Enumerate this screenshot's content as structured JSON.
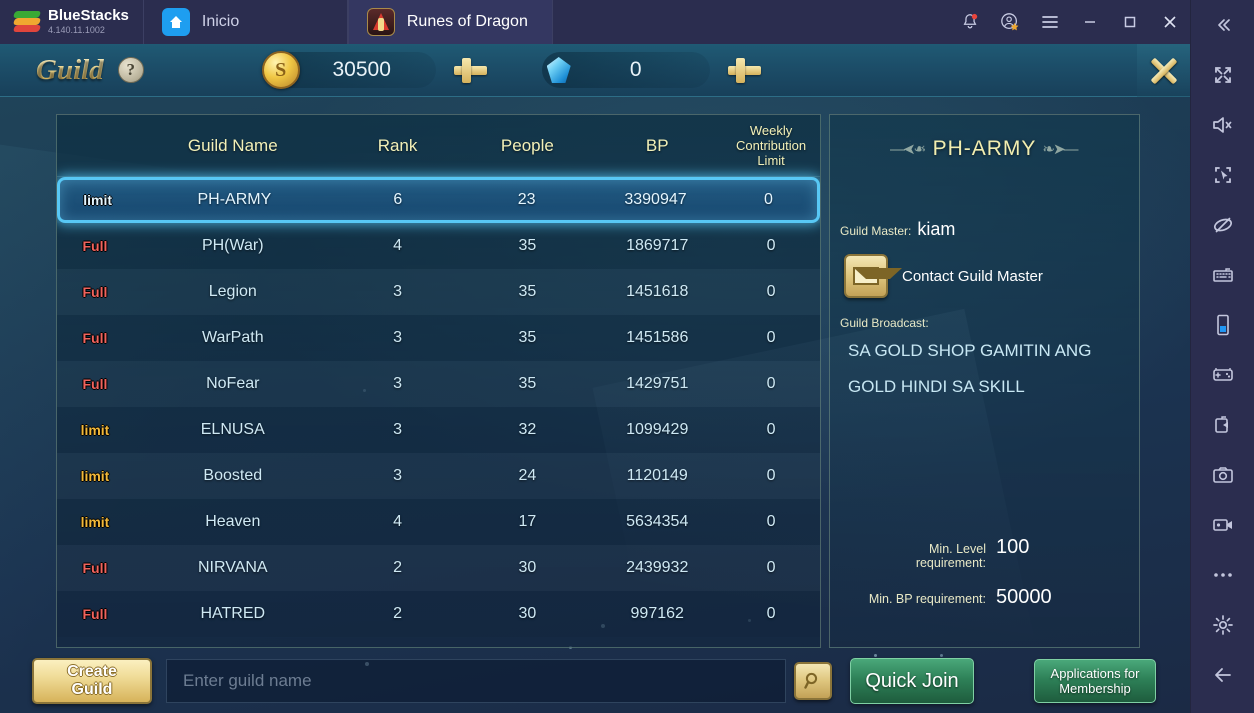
{
  "bluestacks": {
    "brand": "BlueStacks",
    "version": "4.140.11.1002",
    "tabs": [
      {
        "label": "Inicio",
        "icon": "home-icon"
      },
      {
        "label": "Runes of Dragon",
        "icon": "game-icon"
      }
    ],
    "window_buttons": [
      "notifications-bell-icon",
      "account-star-icon",
      "menu-icon",
      "minimize-icon",
      "maximize-icon",
      "close-icon"
    ],
    "sidebar_icons": [
      "collapse-chevrons-icon",
      "fullscreen-icon",
      "mute-icon",
      "cursor-target-icon",
      "eye-off-icon",
      "keyboard-icon",
      "phone-rotate-icon",
      "gamepad-icon",
      "multi-instance-icon",
      "screenshot-camera-icon",
      "record-video-icon",
      "more-options-icon",
      "settings-gear-icon",
      "back-arrow-icon"
    ]
  },
  "header": {
    "title": "Guild",
    "help_icon": "help-question-icon",
    "gold_icon": "gold-coin-icon",
    "gold": "30500",
    "gold_add": "add-gold-button",
    "gem_icon": "blue-gem-icon",
    "gems": "0",
    "gem_add": "add-gem-button",
    "close_icon": "close-screen-icon"
  },
  "table": {
    "columns": [
      "",
      "Guild Name",
      "Rank",
      "People",
      "BP",
      "Weekly\nContribution Limit"
    ],
    "col_guild_name": "Guild Name",
    "col_rank": "Rank",
    "col_people": "People",
    "col_bp": "BP",
    "col_weekly_l1": "Weekly",
    "col_weekly_l2": "Contribution Limit",
    "rows": [
      {
        "tag": "limit",
        "tag_type": "limit",
        "name": "PH-ARMY",
        "rank": "6",
        "people": "23",
        "bp": "3390947",
        "weekly": "0",
        "selected": true
      },
      {
        "tag": "Full",
        "tag_type": "full",
        "name": "PH(War)",
        "rank": "4",
        "people": "35",
        "bp": "1869717",
        "weekly": "0",
        "selected": false
      },
      {
        "tag": "Full",
        "tag_type": "full",
        "name": "Legion",
        "rank": "3",
        "people": "35",
        "bp": "1451618",
        "weekly": "0",
        "selected": false
      },
      {
        "tag": "Full",
        "tag_type": "full",
        "name": "WarPath",
        "rank": "3",
        "people": "35",
        "bp": "1451586",
        "weekly": "0",
        "selected": false
      },
      {
        "tag": "Full",
        "tag_type": "full",
        "name": "NoFear",
        "rank": "3",
        "people": "35",
        "bp": "1429751",
        "weekly": "0",
        "selected": false
      },
      {
        "tag": "limit",
        "tag_type": "limit",
        "name": "ELNUSA",
        "rank": "3",
        "people": "32",
        "bp": "1099429",
        "weekly": "0",
        "selected": false
      },
      {
        "tag": "limit",
        "tag_type": "limit",
        "name": "Boosted",
        "rank": "3",
        "people": "24",
        "bp": "1120149",
        "weekly": "0",
        "selected": false
      },
      {
        "tag": "limit",
        "tag_type": "limit",
        "name": "Heaven",
        "rank": "4",
        "people": "17",
        "bp": "5634354",
        "weekly": "0",
        "selected": false
      },
      {
        "tag": "Full",
        "tag_type": "full",
        "name": "NIRVANA",
        "rank": "2",
        "people": "30",
        "bp": "2439932",
        "weekly": "0",
        "selected": false
      },
      {
        "tag": "Full",
        "tag_type": "full",
        "name": "HATRED",
        "rank": "2",
        "people": "30",
        "bp": "997162",
        "weekly": "0",
        "selected": false
      }
    ]
  },
  "detail": {
    "guild_name": "PH-ARMY",
    "guild_master_label": "Guild Master:",
    "guild_master": "kiam",
    "contact_label": "Contact Guild Master",
    "mail_icon": "envelope-icon",
    "broadcast_label": "Guild Broadcast:",
    "broadcast_line1": "SA GOLD SHOP GAMITIN ANG",
    "broadcast_line2": "GOLD HINDI SA SKILL",
    "min_level_l1": "Min. Level",
    "min_level_l2": "requirement:",
    "min_level_value": "100",
    "min_bp_label": "Min. BP requirement:",
    "min_bp_value": "50000"
  },
  "bottom": {
    "create_l1": "Create",
    "create_l2": "Guild",
    "search_placeholder": "Enter guild name",
    "search_value": "",
    "search_icon": "magnifier-icon",
    "quick_join": "Quick Join",
    "apps_l1": "Applications for",
    "apps_l2": "Membership"
  },
  "colors": {
    "accent_gold": "#f3dd93",
    "selected_border": "#58c8f5",
    "tag_full": "#f0635d",
    "tag_limit": "#f3b93a",
    "green_button": "#2e8158",
    "shell": "#2b2d4f"
  }
}
